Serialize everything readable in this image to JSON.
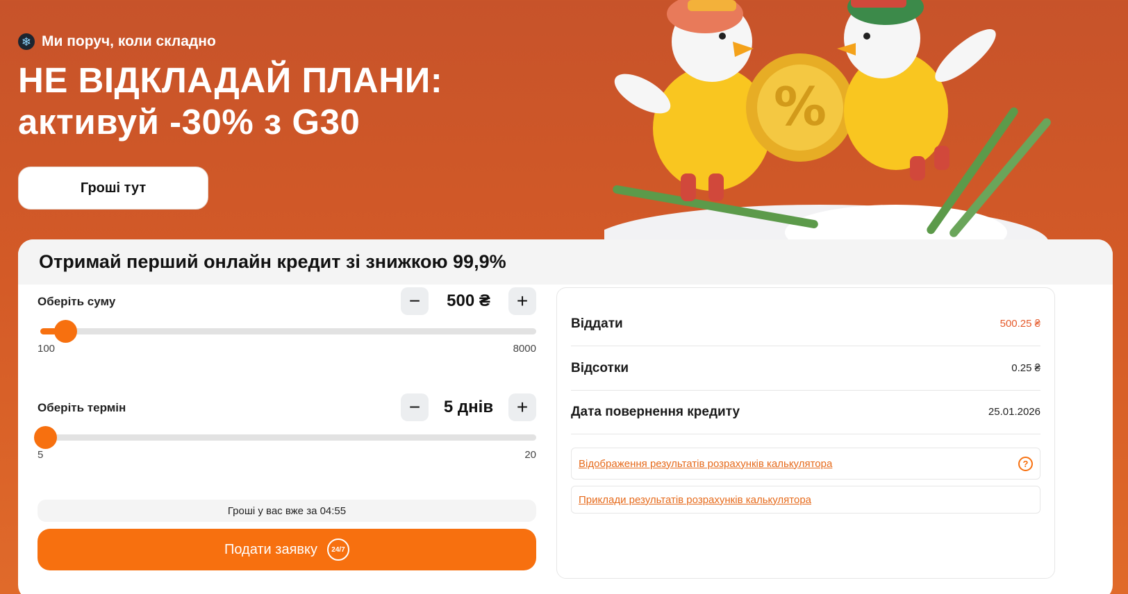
{
  "hero": {
    "tagline": "Ми поруч, коли складно",
    "title_line1": "НЕ ВІДКЛАДАЙ ПЛАНИ:",
    "title_line2": "активуй -30% з G30",
    "cta_label": "Гроші тут",
    "tag_icon": "snowflake-icon",
    "coin_symbol": "%"
  },
  "card": {
    "title": "Отримай перший онлайн кредит зі знижкою 99,9%"
  },
  "amount": {
    "label": "Оберіть суму",
    "value_text": "500 ₴",
    "value": 500,
    "min_label": "100",
    "max_label": "8000",
    "min": 100,
    "max": 8000,
    "minus": "−",
    "plus": "+"
  },
  "term": {
    "label": "Оберіть термін",
    "value_text": "5 днів",
    "value": 5,
    "min_label": "5",
    "max_label": "20",
    "min": 5,
    "max": 20,
    "minus": "−",
    "plus": "+"
  },
  "timer_text": "Гроші у вас вже за 04:55",
  "apply": {
    "label": "Подати заявку",
    "icon_text": "24/7",
    "icon": "clock-24-7-icon"
  },
  "summary": {
    "rows": [
      {
        "label": "Віддати",
        "value": "500.25 ₴"
      },
      {
        "label": "Відсотки",
        "value": "0.25 ₴"
      },
      {
        "label": "Дата повернення кредиту",
        "value": "25.01.2026"
      }
    ],
    "link1": "Відображення результатів розрахунків калькулятора",
    "link2": "Приклади результатів розрахунків калькулятора",
    "help_icon": "?"
  },
  "colors": {
    "accent": "#f7700f",
    "hero_bg": "#d35a27",
    "price_accent": "#e55a2b"
  }
}
